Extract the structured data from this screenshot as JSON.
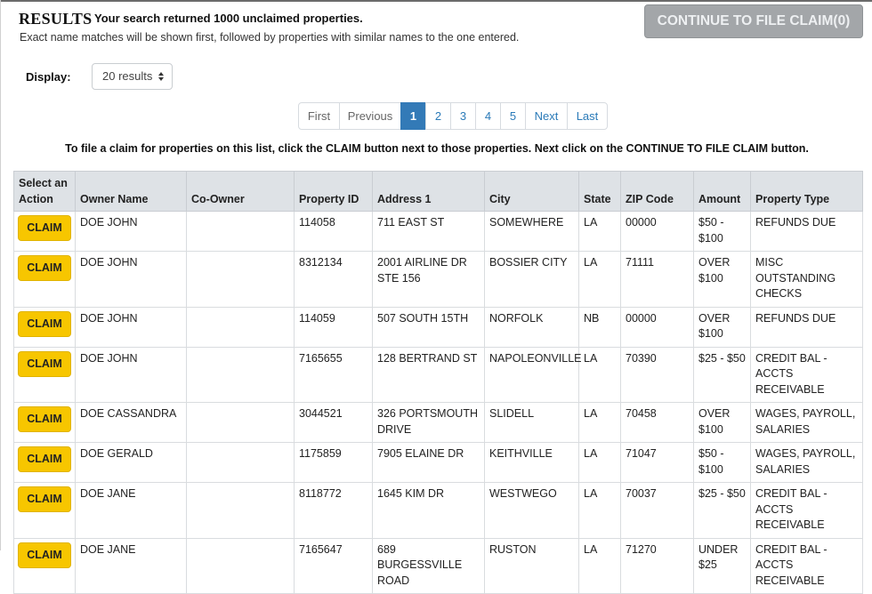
{
  "header": {
    "title": "RESULTS",
    "count_text": "Your search returned 1000 unclaimed properties.",
    "subtitle": "Exact name matches will be shown first, followed by properties with similar names to the one entered.",
    "continue_label": "CONTINUE TO FILE CLAIM(0)"
  },
  "display": {
    "label": "Display:",
    "selected": "20 results"
  },
  "pagination": {
    "first": "First",
    "previous": "Previous",
    "pages": [
      "1",
      "2",
      "3",
      "4",
      "5"
    ],
    "active_page": "1",
    "next": "Next",
    "last": "Last"
  },
  "instruction": "To file a claim for properties on this list, click the CLAIM button next to those properties. Next click on the CONTINUE TO FILE CLAIM button.",
  "table": {
    "headers": [
      "Select an Action",
      "Owner Name",
      "Co-Owner",
      "Property ID",
      "Address 1",
      "City",
      "State",
      "ZIP Code",
      "Amount",
      "Property Type"
    ],
    "claim_label": "CLAIM",
    "rows": [
      {
        "owner": "DOE JOHN",
        "co_owner": "",
        "property_id": "114058",
        "address": "711 EAST ST",
        "city": "SOMEWHERE",
        "state": "LA",
        "zip": "00000",
        "amount": "$50 - $100",
        "type": "REFUNDS DUE"
      },
      {
        "owner": "DOE JOHN",
        "co_owner": "",
        "property_id": "8312134",
        "address": "2001 AIRLINE DR STE 156",
        "city": "BOSSIER CITY",
        "state": "LA",
        "zip": "71111",
        "amount": "OVER $100",
        "type": "MISC OUTSTANDING CHECKS"
      },
      {
        "owner": "DOE JOHN",
        "co_owner": "",
        "property_id": "114059",
        "address": "507 SOUTH 15TH",
        "city": "NORFOLK",
        "state": "NB",
        "zip": "00000",
        "amount": "OVER $100",
        "type": "REFUNDS DUE"
      },
      {
        "owner": "DOE JOHN",
        "co_owner": "",
        "property_id": "7165655",
        "address": "128 BERTRAND ST",
        "city": "NAPOLEONVILLE",
        "state": "LA",
        "zip": "70390",
        "amount": "$25 - $50",
        "type": "CREDIT BAL - ACCTS RECEIVABLE"
      },
      {
        "owner": "DOE CASSANDRA",
        "co_owner": "",
        "property_id": "3044521",
        "address": "326 PORTSMOUTH DRIVE",
        "city": "SLIDELL",
        "state": "LA",
        "zip": "70458",
        "amount": "OVER $100",
        "type": "WAGES, PAYROLL, SALARIES"
      },
      {
        "owner": "DOE GERALD",
        "co_owner": "",
        "property_id": "1175859",
        "address": "7905 ELAINE DR",
        "city": "KEITHVILLE",
        "state": "LA",
        "zip": "71047",
        "amount": "$50 - $100",
        "type": "WAGES, PAYROLL, SALARIES"
      },
      {
        "owner": "DOE JANE",
        "co_owner": "",
        "property_id": "8118772",
        "address": "1645 KIM DR",
        "city": "WESTWEGO",
        "state": "LA",
        "zip": "70037",
        "amount": "$25 - $50",
        "type": "CREDIT BAL - ACCTS RECEIVABLE"
      },
      {
        "owner": "DOE JANE",
        "co_owner": "",
        "property_id": "7165647",
        "address": "689 BURGESSVILLE ROAD",
        "city": "RUSTON",
        "state": "LA",
        "zip": "71270",
        "amount": "UNDER $25",
        "type": "CREDIT BAL - ACCTS RECEIVABLE"
      }
    ]
  }
}
